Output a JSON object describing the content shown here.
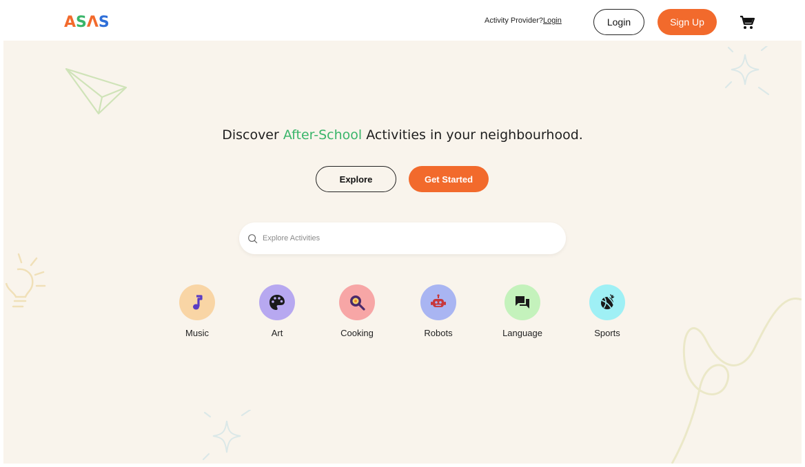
{
  "header": {
    "logo": [
      "A",
      "S",
      "Λ",
      "S"
    ],
    "provider_text": "Activity Provider?",
    "provider_link": "Login",
    "login_label": "Login",
    "signup_label": "Sign Up",
    "cart_icon": "cart-icon"
  },
  "hero": {
    "headline_pre": "Discover ",
    "headline_accent": "After-School",
    "headline_post": " Activities in your neighbourhood.",
    "explore_label": "Explore",
    "get_started_label": "Get Started"
  },
  "search": {
    "placeholder": "Explore Activities",
    "icon": "search-icon"
  },
  "categories": [
    {
      "label": "Music",
      "icon": "music-note-icon",
      "bg": "#f9d5a5",
      "fg": "#5b3cc4"
    },
    {
      "label": "Art",
      "icon": "palette-icon",
      "bg": "#b7a8f0",
      "fg": "#1a1a1a"
    },
    {
      "label": "Cooking",
      "icon": "frying-pan-icon",
      "bg": "#f7a6a6",
      "fg": "#4a2a6b"
    },
    {
      "label": "Robots",
      "icon": "robot-icon",
      "bg": "#a9b5f2",
      "fg": "#c8383b"
    },
    {
      "label": "Language",
      "icon": "chat-bubbles-icon",
      "bg": "#c4f2bc",
      "fg": "#1a1a1a"
    },
    {
      "label": "Sports",
      "icon": "basketball-icon",
      "bg": "#9ff0f5",
      "fg": "#1a1a1a"
    }
  ],
  "colors": {
    "brand_orange": "#f26a2c",
    "accent_green": "#3ab56a",
    "background": "#f9f4ec",
    "logo": [
      "#f26a2c",
      "#3ab56a",
      "#f26a2c",
      "#2f6fd8"
    ]
  }
}
